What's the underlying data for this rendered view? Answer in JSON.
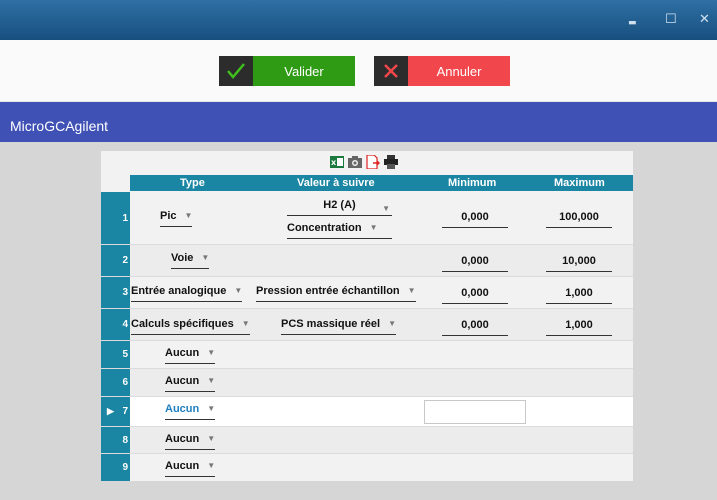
{
  "window": {
    "minimize_glyph": "▬",
    "maximize_glyph": "☐",
    "close_glyph": "✕"
  },
  "actions": {
    "validate_label": "Valider",
    "cancel_label": "Annuler"
  },
  "app": {
    "title": "MicroGCAgilent"
  },
  "toolbar": {
    "icons": [
      "excel-icon",
      "camera-icon",
      "pdf-export-icon",
      "print-icon"
    ]
  },
  "table": {
    "headers": {
      "type": "Type",
      "value": "Valeur à suivre",
      "min": "Minimum",
      "max": "Maximum"
    },
    "rows": [
      {
        "n": "1",
        "type": "Pic",
        "value1": "H2 (A)",
        "value2": "Concentration",
        "min": "0,000",
        "max": "100,000"
      },
      {
        "n": "2",
        "type": "Voie",
        "min": "0,000",
        "max": "10,000"
      },
      {
        "n": "3",
        "type": "Entrée analogique",
        "value1": "Pression entrée échantillon",
        "min": "0,000",
        "max": "1,000"
      },
      {
        "n": "4",
        "type": "Calculs spécifiques",
        "value1": "PCS massique réel",
        "min": "0,000",
        "max": "1,000"
      },
      {
        "n": "5",
        "type": "Aucun"
      },
      {
        "n": "6",
        "type": "Aucun"
      },
      {
        "n": "7",
        "type": "Aucun",
        "pointer": "▶"
      },
      {
        "n": "8",
        "type": "Aucun"
      },
      {
        "n": "9",
        "type": "Aucun"
      }
    ]
  },
  "colors": {
    "header": "#1b86a3",
    "appbar": "#3f51b5",
    "validate": "#2f9b14",
    "cancel": "#f1464b"
  }
}
